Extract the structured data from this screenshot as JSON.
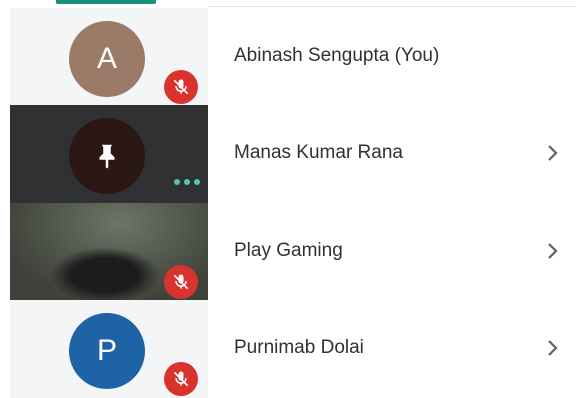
{
  "participants": [
    {
      "name": "Abinash Sengupta (You)",
      "avatar_letter": "A",
      "tile": "avatar",
      "muted": true,
      "has_chevron": false,
      "avatar_color": "#9b7a67"
    },
    {
      "name": "Manas Kumar Rana",
      "avatar_letter": "",
      "tile": "pin",
      "muted": false,
      "speaking_dots": true,
      "has_chevron": true,
      "avatar_color": "#2b1713"
    },
    {
      "name": "Play Gaming",
      "avatar_letter": "",
      "tile": "video",
      "muted": true,
      "has_chevron": true
    },
    {
      "name": "Purnimab Dolai",
      "avatar_letter": "P",
      "tile": "avatar",
      "muted": true,
      "has_chevron": true,
      "avatar_color": "#1e63a6"
    }
  ],
  "colors": {
    "mute_badge": "#d9332d",
    "accent": "#1a8f79",
    "speaking_dots": "#4fc9ad",
    "text": "#303134"
  },
  "icons": {
    "mute": "mic-off-icon",
    "pin": "pin-icon",
    "chevron": "chevron-right-icon",
    "speaking": "more-dots-icon"
  }
}
